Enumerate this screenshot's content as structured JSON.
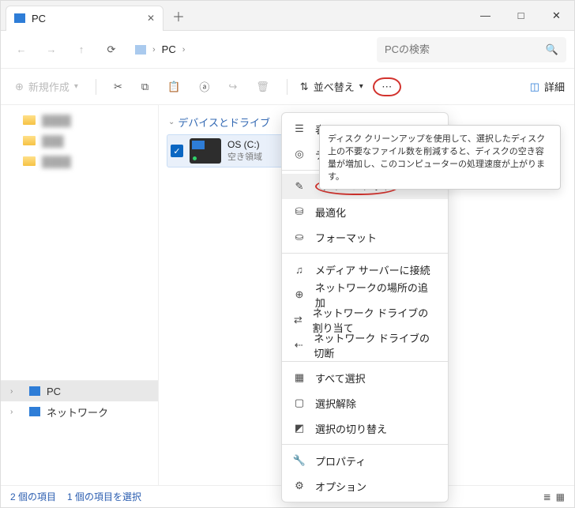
{
  "tab": {
    "title": "PC"
  },
  "breadcrumb": {
    "node1": "PC"
  },
  "search": {
    "placeholder": "PCの検索"
  },
  "toolbar": {
    "new_label": "新規作成",
    "sort_label": "並べ替え",
    "details_label": "詳細"
  },
  "section": {
    "devices_drives": "デバイスとドライブ"
  },
  "drive": {
    "name": "OS (C:)",
    "sub": "空き領域"
  },
  "sidebar": {
    "pc_label": "PC",
    "network_label": "ネットワーク"
  },
  "tooltip": {
    "text": "ディスク クリーンアップを使用して、選択したディスク上の不要なファイル数を削減すると、ディスクの空き容量が増加し、このコンピューターの処理速度が上がります。"
  },
  "context_menu": {
    "display": "表示",
    "de": "デ",
    "cleanup": "クリーンアップ",
    "optimize": "最適化",
    "format": "フォーマット",
    "media_server": "メディア サーバーに接続",
    "add_net_loc": "ネットワークの場所の追加",
    "map_net_drive": "ネットワーク ドライブの割り当て",
    "disconnect_net_drive": "ネットワーク ドライブの切断",
    "select_all": "すべて選択",
    "select_none": "選択解除",
    "invert_selection": "選択の切り替え",
    "properties": "プロパティ",
    "options": "オプション"
  },
  "status": {
    "items": "2 個の項目",
    "selected": "1 個の項目を選択"
  }
}
